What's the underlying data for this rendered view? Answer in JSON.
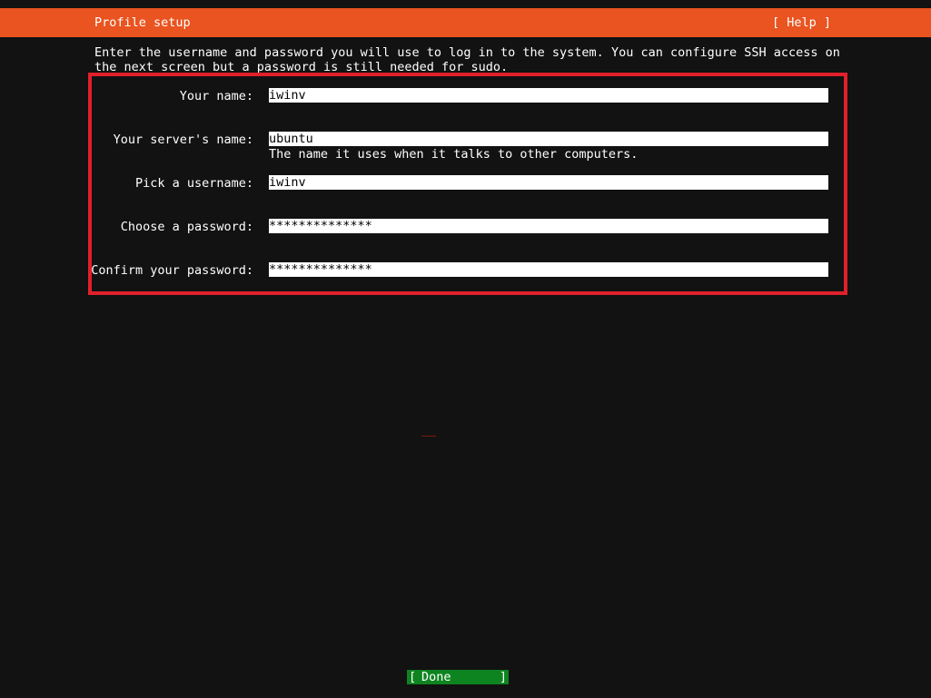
{
  "header": {
    "title": "Profile setup",
    "help_label": "[ Help ]"
  },
  "intro": {
    "line1": "Enter the username and password you will use to log in to the system. You can configure SSH access on",
    "line2": "the next screen but a password is still needed for sudo."
  },
  "form": {
    "name": {
      "label": "Your name:",
      "value": "iwinv"
    },
    "server_name": {
      "label": "Your server's name:",
      "value": "ubuntu",
      "hint": "The name it uses when it talks to other computers."
    },
    "username": {
      "label": "Pick a username:",
      "value": "iwinv"
    },
    "password": {
      "label": "Choose a password:",
      "value": "**************"
    },
    "confirm_password": {
      "label": "Confirm your password:",
      "value": "**************"
    }
  },
  "footer": {
    "done_label": "Done",
    "done_open": "[",
    "done_close": "]"
  },
  "colors": {
    "header_bg": "#e95420",
    "background": "#121212",
    "done_bg": "#0e8420",
    "highlight_border": "#e0202a"
  }
}
